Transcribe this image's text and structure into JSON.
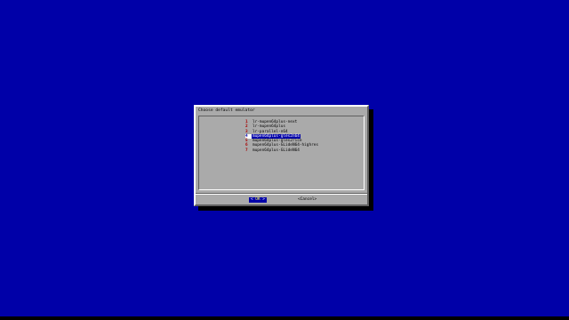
{
  "theme": {
    "background": "#0000a8",
    "dialog_bg": "#aaaaaa",
    "highlight_bg": "#0000a8",
    "highlight_fg": "#ffffff",
    "number_color": "#a80000"
  },
  "dialog": {
    "title": "Choose default emulator",
    "items": [
      {
        "num": "1",
        "label": "lr-mupen64plus-next",
        "selected": false
      },
      {
        "num": "2",
        "label": "lr-mupen64plus",
        "selected": false
      },
      {
        "num": "3",
        "label": "lr-parallel-n64",
        "selected": false
      },
      {
        "num": "4",
        "label": "mupen64plus-gles2n64",
        "selected": true
      },
      {
        "num": "5",
        "label": "mupen64plus-gles2rice",
        "selected": false
      },
      {
        "num": "6",
        "label": "mupen64plus-GLideN64-highres",
        "selected": false
      },
      {
        "num": "7",
        "label": "mupen64plus-GLideN64",
        "selected": false
      }
    ],
    "ok_button": {
      "left": "<",
      "label": " OK ",
      "right": ">"
    },
    "cancel_button": {
      "left": "<",
      "label": "Cancel",
      "right": ">"
    }
  }
}
